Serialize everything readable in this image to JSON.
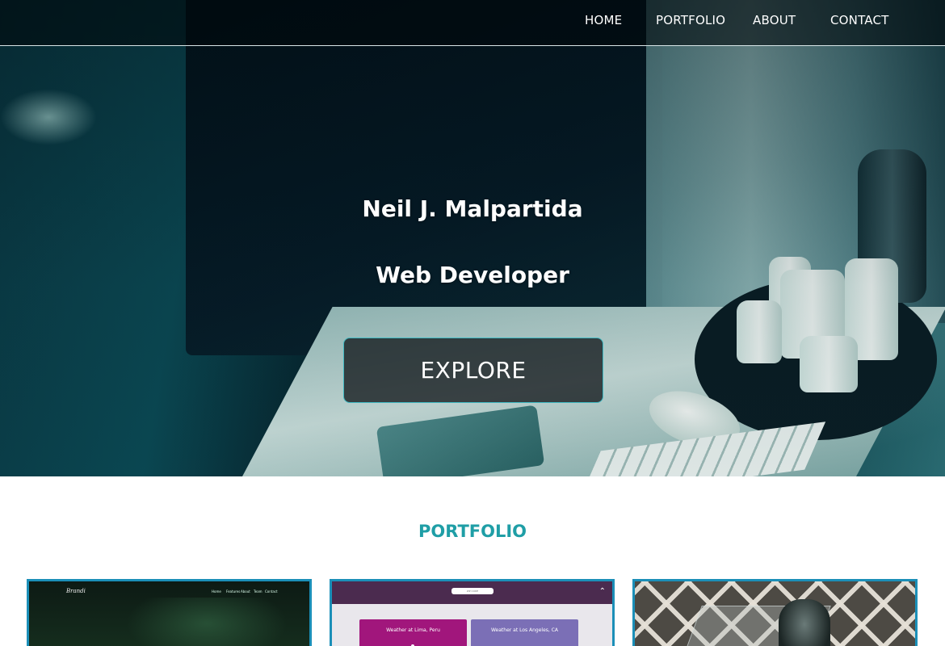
{
  "nav": {
    "items": [
      {
        "label": "HOME"
      },
      {
        "label": "PORTFOLIO"
      },
      {
        "label": "ABOUT"
      },
      {
        "label": "CONTACT"
      }
    ]
  },
  "hero": {
    "name": "Neil J. Malpartida",
    "role": "Web Developer",
    "cta_label": "EXPLORE"
  },
  "portfolio": {
    "title": "PORTFOLIO",
    "cards": [
      {
        "logo": "Brandi",
        "nav": [
          "Home",
          "Features",
          "About",
          "Team",
          "Contact"
        ]
      },
      {
        "search_label": "ZIP CODE",
        "boxes": [
          "Weather at Lima, Peru",
          "Weather at Los Angeles, CA"
        ]
      },
      {}
    ]
  },
  "colors": {
    "accent": "#1f9ea6",
    "card_border": "#1b8fb8",
    "button_border": "#3fb9c2",
    "weather_box_1": "#a1167c",
    "weather_box_2": "#7b6fb6",
    "weather_header": "#4b2b4f"
  }
}
